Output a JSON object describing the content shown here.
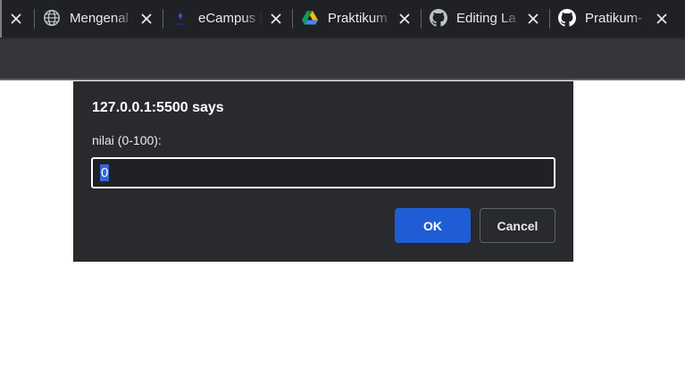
{
  "browser": {
    "tabs": [
      {
        "title": "Mengenal",
        "favicon": "globe-icon"
      },
      {
        "title": "eCampus |",
        "favicon": "campus-logo-icon"
      },
      {
        "title": "Praktikum",
        "favicon": "google-drive-icon"
      },
      {
        "title": "Editing La",
        "favicon": "github-icon"
      },
      {
        "title": "Pratikum-",
        "favicon": "github-icon"
      }
    ]
  },
  "dialog": {
    "title": "127.0.0.1:5500 says",
    "message": "nilai (0-100):",
    "input_value": "0",
    "ok_label": "OK",
    "cancel_label": "Cancel"
  },
  "colors": {
    "tabstrip_bg": "#202124",
    "toolbar_bg": "#35363a",
    "dialog_bg": "#292a2d",
    "ok_button": "#1f5dd6",
    "selection": "#3367d6"
  }
}
